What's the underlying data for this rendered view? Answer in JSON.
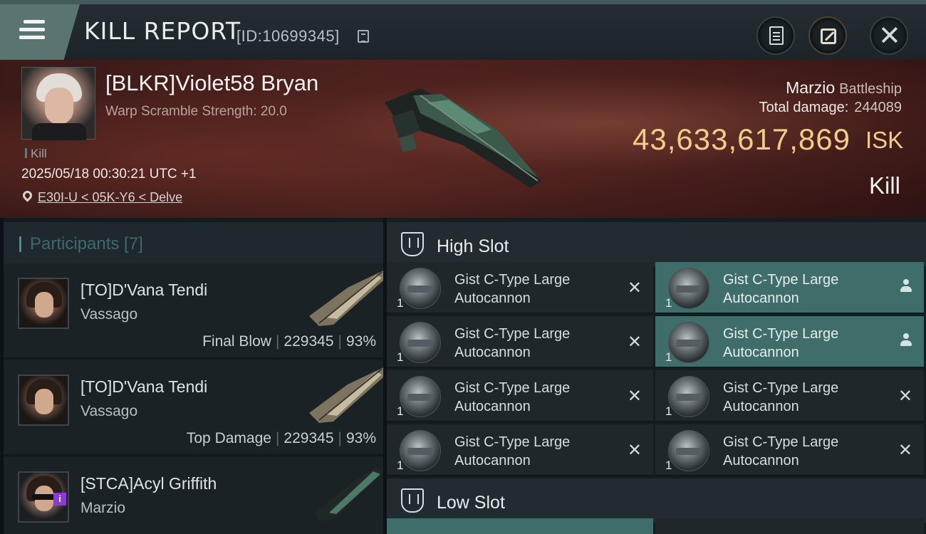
{
  "header": {
    "title": "KILL REPORT",
    "kill_id": "[ID:10699345]",
    "icons": [
      "menu-icon",
      "copy-icon",
      "report-icon",
      "share-icon",
      "close-icon"
    ]
  },
  "victim": {
    "name": "[BLKR]Violet58 Bryan",
    "scramble": "Warp Scramble Strength: 20.0",
    "tag": "Kill",
    "timestamp": "2025/05/18 00:30:21 UTC +1",
    "location": "E30I-U < 05K-Y6 < Delve",
    "ship_name": "Marzio",
    "ship_class": "Battleship",
    "damage_label": "Total damage:",
    "damage_value": "244089",
    "isk_value": "43,633,617,869",
    "isk_unit": "ISK",
    "result": "Kill"
  },
  "participants": {
    "label": "Participants [7]",
    "rows": [
      {
        "name": "[TO]D'Vana Tendi",
        "ship": "Vassago",
        "role": "Final Blow",
        "damage": "229345",
        "percent": "93%"
      },
      {
        "name": "[TO]D'Vana Tendi",
        "ship": "Vassago",
        "role": "Top Damage",
        "damage": "229345",
        "percent": "93%"
      },
      {
        "name": "[STCA]Acyl Griffith",
        "ship": "Marzio"
      }
    ]
  },
  "fitting": {
    "high_slot_label": "High Slot",
    "low_slot_label": "Low Slot",
    "modules": [
      {
        "qty": "1",
        "line1": "Gist C-Type Large",
        "line2": "Autocannon",
        "status": "destroyed"
      },
      {
        "qty": "1",
        "line1": "Gist C-Type Large",
        "line2": "Autocannon",
        "status": "dropped"
      },
      {
        "qty": "1",
        "line1": "Gist C-Type Large",
        "line2": "Autocannon",
        "status": "destroyed"
      },
      {
        "qty": "1",
        "line1": "Gist C-Type Large",
        "line2": "Autocannon",
        "status": "dropped"
      },
      {
        "qty": "1",
        "line1": "Gist C-Type Large",
        "line2": "Autocannon",
        "status": "destroyed"
      },
      {
        "qty": "1",
        "line1": "Gist C-Type Large",
        "line2": "Autocannon",
        "status": "destroyed"
      },
      {
        "qty": "1",
        "line1": "Gist C-Type Large",
        "line2": "Autocannon",
        "status": "destroyed"
      },
      {
        "qty": "1",
        "line1": "Gist C-Type Large",
        "line2": "Autocannon",
        "status": "destroyed"
      }
    ],
    "status_glyph": "✕"
  },
  "colors": {
    "accent_teal": "#3f6e6a",
    "isk_gold": "#f3cc8a",
    "banner_red": "#4d2421"
  }
}
